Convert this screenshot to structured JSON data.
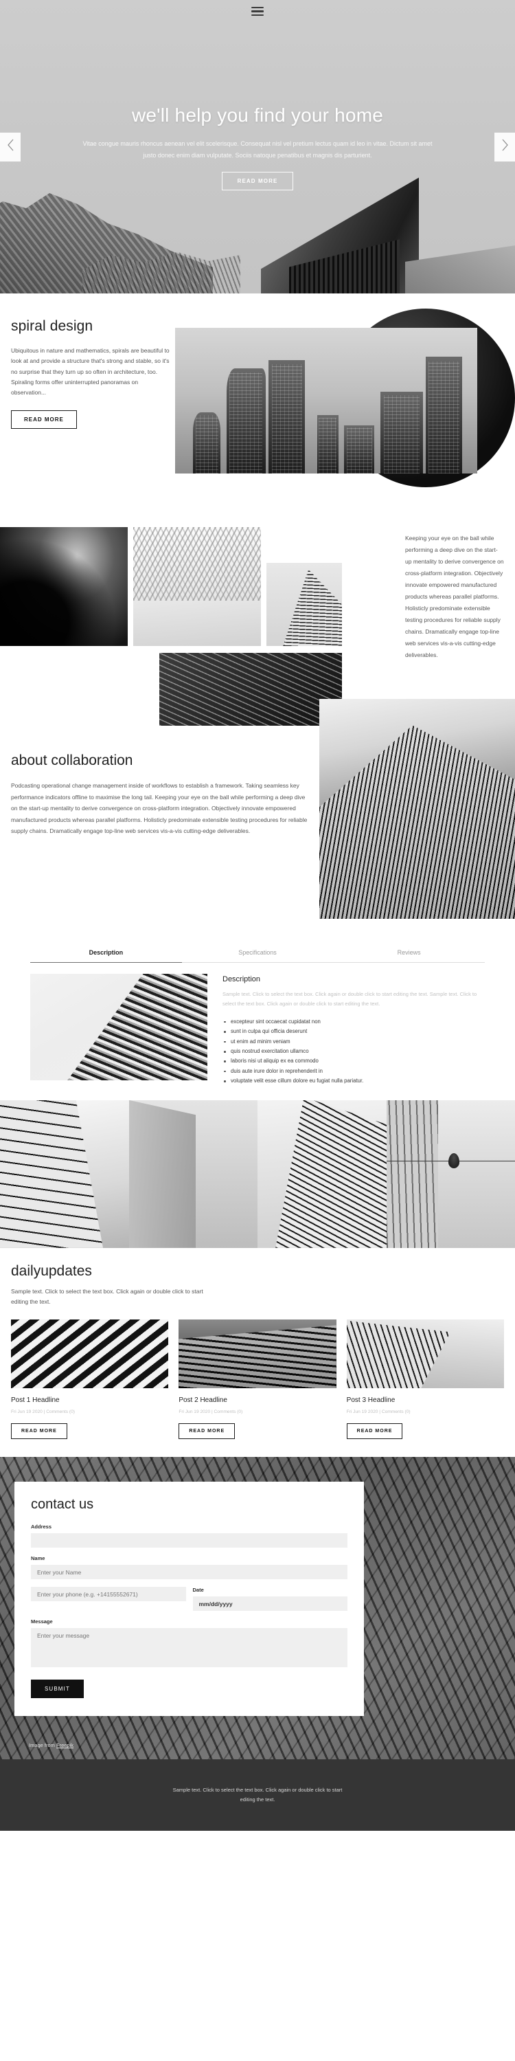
{
  "nav": {
    "menu_icon": "hamburger-icon"
  },
  "hero": {
    "title": "we'll help you find your home",
    "subtitle": "Vitae congue mauris rhoncus aenean vel elit scelerisque. Consequat nisl vel pretium lectus quam id leo in vitae. Dictum sit amet justo donec enim diam vulputate. Sociis natoque penatibus et magnis dis parturient.",
    "cta": "READ MORE",
    "prev_icon": "chevron-left-icon",
    "next_icon": "chevron-right-icon"
  },
  "spiral": {
    "heading": "spiral design",
    "body": "Ubiquitous in nature and mathematics, spirals are beautiful to look at and provide a structure that's strong and stable, so it's no surprise that they turn up so often in architecture, too. Spiraling forms offer uninterrupted panoramas on observation...",
    "cta": "READ MORE"
  },
  "collage": {
    "body": "Keeping your eye on the ball while performing a deep dive on the start-up mentality to derive convergence on cross-platform integration. Objectively innovate empowered manufactured products whereas parallel platforms. Holisticly predominate extensible testing procedures for reliable supply chains. Dramatically engage top-line web services vis-a-vis cutting-edge deliverables."
  },
  "about": {
    "heading": "about collaboration",
    "body": "Podcasting operational change management inside of workflows to establish a framework. Taking seamless key performance indicators offline to maximise the long tail. Keeping your eye on the ball while performing a deep dive on the start-up mentality to derive convergence on cross-platform integration. Objectively innovate empowered manufactured products whereas parallel platforms. Holisticly predominate extensible testing procedures for reliable supply chains. Dramatically engage top-line web services vis-a-vis cutting-edge deliverables."
  },
  "tabs": {
    "items": [
      {
        "label": "Description",
        "active": true
      },
      {
        "label": "Specifications",
        "active": false
      },
      {
        "label": "Reviews",
        "active": false
      }
    ],
    "panel": {
      "heading": "Description",
      "paragraph": "Sample text. Click to select the text box. Click again or double click to start editing the text. Sample text. Click to select the text box. Click again or double click to start editing the text.",
      "bullets": [
        "excepteur sint occaecat cupidatat non",
        "sunt in culpa qui officia deserunt",
        "ut enim ad minim veniam",
        "quis nostrud exercitation ullamco",
        "laboris nisi ut aliquip ex ea commodo",
        "duis aute irure dolor in reprehenderit in",
        "voluptate velit esse cillum dolore eu fugiat nulla pariatur."
      ]
    }
  },
  "updates": {
    "heading": "dailyupdates",
    "lede": "Sample text. Click to select the text box. Click again or double click to start editing the text.",
    "posts": [
      {
        "title": "Post 1 Headline",
        "meta": "Fri Jun 19 2020  |  Comments (0)",
        "cta": "READ MORE"
      },
      {
        "title": "Post 2 Headline",
        "meta": "Fri Jun 19 2020  |  Comments (0)",
        "cta": "READ MORE"
      },
      {
        "title": "Post 3 Headline",
        "meta": "Fri Jun 19 2020  |  Comments (0)",
        "cta": "READ MORE"
      }
    ]
  },
  "contact": {
    "heading": "contact us",
    "address_label": "Address",
    "address_value": "",
    "name_label": "Name",
    "name_placeholder": "Enter your Name",
    "phone_placeholder": "Enter your phone (e.g. +14155552671)",
    "date_label": "Date",
    "date_value": "mm/dd/yyyy",
    "message_label": "Message",
    "message_placeholder": "Enter your message",
    "submit_label": "SUBMIT",
    "credit_prefix": "Image from ",
    "credit_link": "Freepik"
  },
  "footer": {
    "text": "Sample text. Click to select the text box. Click again or double click to start editing the text."
  },
  "colors": {
    "accent": "#111111",
    "muted": "#9a9a9a",
    "footer_bg": "#353535"
  }
}
